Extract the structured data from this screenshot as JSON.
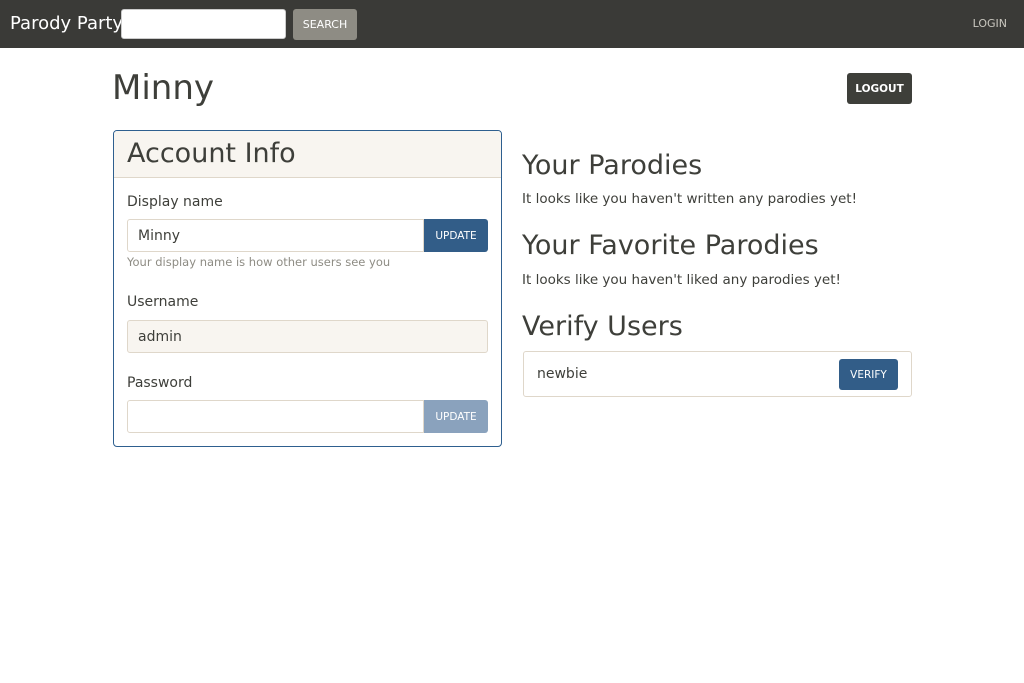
{
  "navbar": {
    "brand": "Parody Party",
    "search_placeholder": "",
    "search_button": "Search",
    "login_link": "Login"
  },
  "page": {
    "title": "Minny",
    "logout_button": "Logout"
  },
  "account": {
    "title": "Account Info",
    "display_name_label": "Display name",
    "display_name_value": "Minny",
    "display_name_update": "Update",
    "display_name_help": "Your display name is how other users see you",
    "username_label": "Username",
    "username_value": "admin",
    "password_label": "Password",
    "password_value": "",
    "password_update": "Update"
  },
  "parodies": {
    "title": "Your Parodies",
    "empty_text": "It looks like you haven't written any parodies yet!"
  },
  "favorites": {
    "title": "Your Favorite Parodies",
    "empty_text": "It looks like you haven't liked any parodies yet!"
  },
  "verify": {
    "title": "Verify Users",
    "users": [
      {
        "name": "newbie",
        "button": "Verify"
      }
    ]
  },
  "colors": {
    "navbar_bg": "#3a3a37",
    "primary": "#325d88",
    "dark_button": "#3e3f3a"
  }
}
